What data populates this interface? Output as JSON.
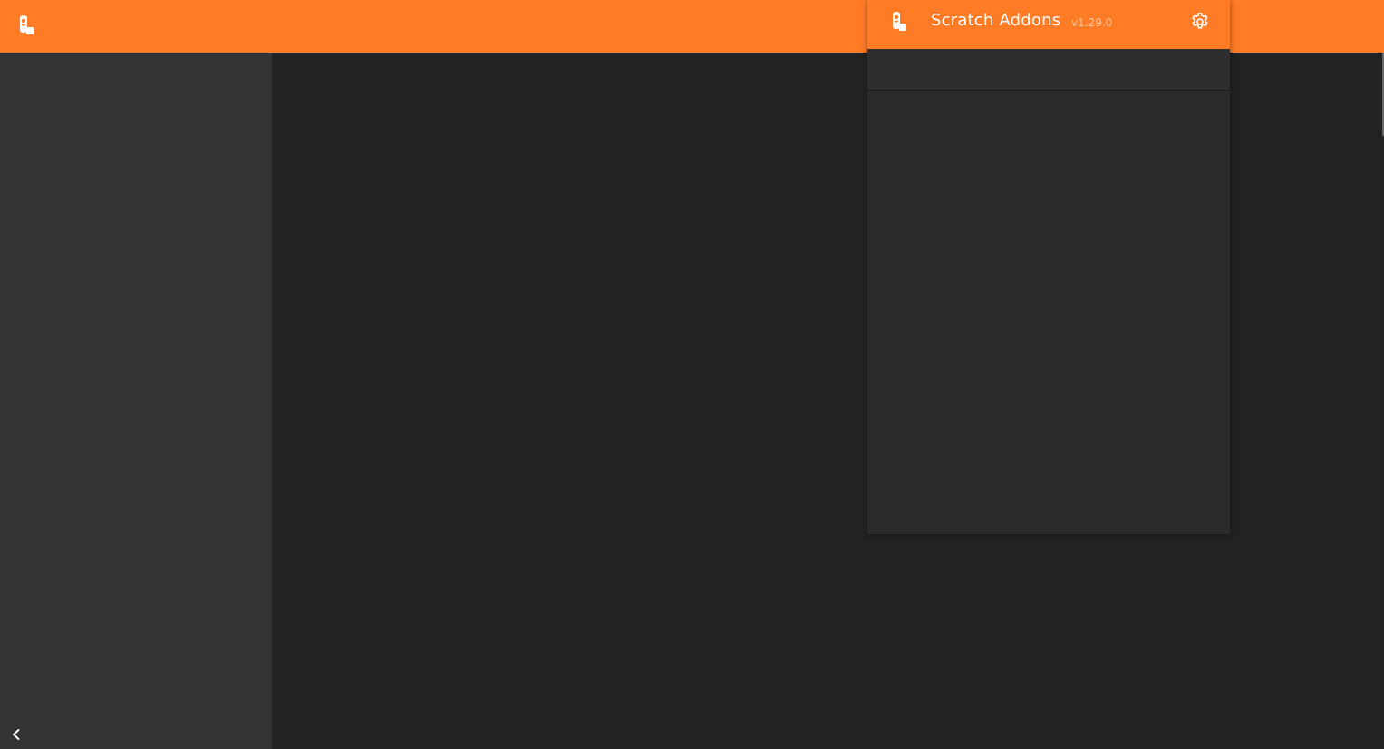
{
  "topbar": {
    "logo_icon": "scratch-addons-logo-icon",
    "accent_color": "#ff7b26"
  },
  "sidebar": {
    "collapse_icon": "chevron-left-icon",
    "background": "#333333"
  },
  "popup": {
    "title": "Scratch Addons",
    "version": "v1.29.0",
    "logo_icon": "scratch-addons-logo-icon",
    "settings_icon": "gear-icon",
    "tabs": [],
    "content": []
  },
  "colors": {
    "accent": "#ff7b26",
    "background": "#222222",
    "panel": "#2a2a2a"
  }
}
